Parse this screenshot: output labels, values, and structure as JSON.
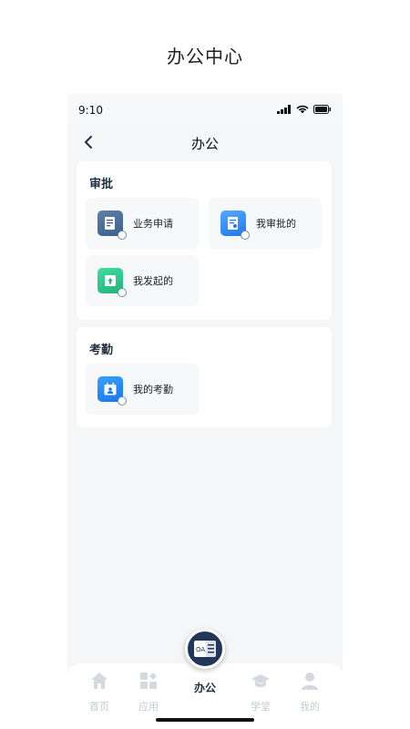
{
  "page_title": "办公中心",
  "status": {
    "time": "9:10"
  },
  "nav": {
    "title": "办公"
  },
  "approval": {
    "title": "审批",
    "items": [
      {
        "label": "业务申请",
        "icon": "document-icon"
      },
      {
        "label": "我审批的",
        "icon": "approval-doc-icon"
      },
      {
        "label": "我发起的",
        "icon": "upload-doc-icon"
      }
    ]
  },
  "attendance": {
    "title": "考勤",
    "items": [
      {
        "label": "我的考勤",
        "icon": "calendar-person-icon"
      }
    ]
  },
  "tabs": [
    {
      "label": "首页",
      "icon": "home-icon"
    },
    {
      "label": "应用",
      "icon": "apps-icon"
    },
    {
      "label": "办公",
      "icon": "office-icon",
      "badge": "OA"
    },
    {
      "label": "学堂",
      "icon": "graduation-cap-icon"
    },
    {
      "label": "我的",
      "icon": "user-icon"
    }
  ]
}
